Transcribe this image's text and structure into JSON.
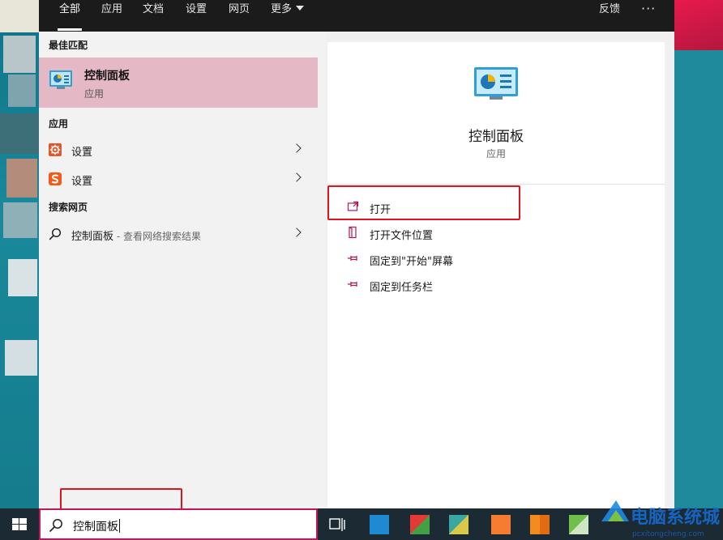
{
  "tabs": {
    "all": "全部",
    "apps": "应用",
    "docs": "文档",
    "settings": "设置",
    "web": "网页",
    "more": "更多",
    "feedback": "反馈",
    "options": "···"
  },
  "left": {
    "best_match_title": "最佳匹配",
    "best_match": {
      "name": "控制面板",
      "type": "应用",
      "icon": "control-panel-icon"
    },
    "apps_title": "应用",
    "apps": [
      {
        "label": "设置",
        "icon": "gear-icon"
      },
      {
        "label": "设置",
        "icon": "sogou-settings-icon"
      }
    ],
    "web_title": "搜索网页",
    "web_result": {
      "label": "控制面板",
      "sub": " - 查看网络搜索结果",
      "icon": "search-icon"
    }
  },
  "preview": {
    "title": "控制面板",
    "type": "应用",
    "actions": [
      {
        "label": "打开",
        "icon": "open-icon"
      },
      {
        "label": "打开文件位置",
        "icon": "file-location-icon"
      },
      {
        "label": "固定到\"开始\"屏幕",
        "icon": "pin-icon"
      },
      {
        "label": "固定到任务栏",
        "icon": "pin-icon"
      }
    ]
  },
  "taskbar": {
    "search_value": "控制面板",
    "watermark": "电脑系统城"
  },
  "colors": {
    "highlight_bg": "#e5b8c6",
    "accent": "#c2185b",
    "annotation_red": "#e0141e",
    "tab_bar": "#1b1b1b"
  }
}
